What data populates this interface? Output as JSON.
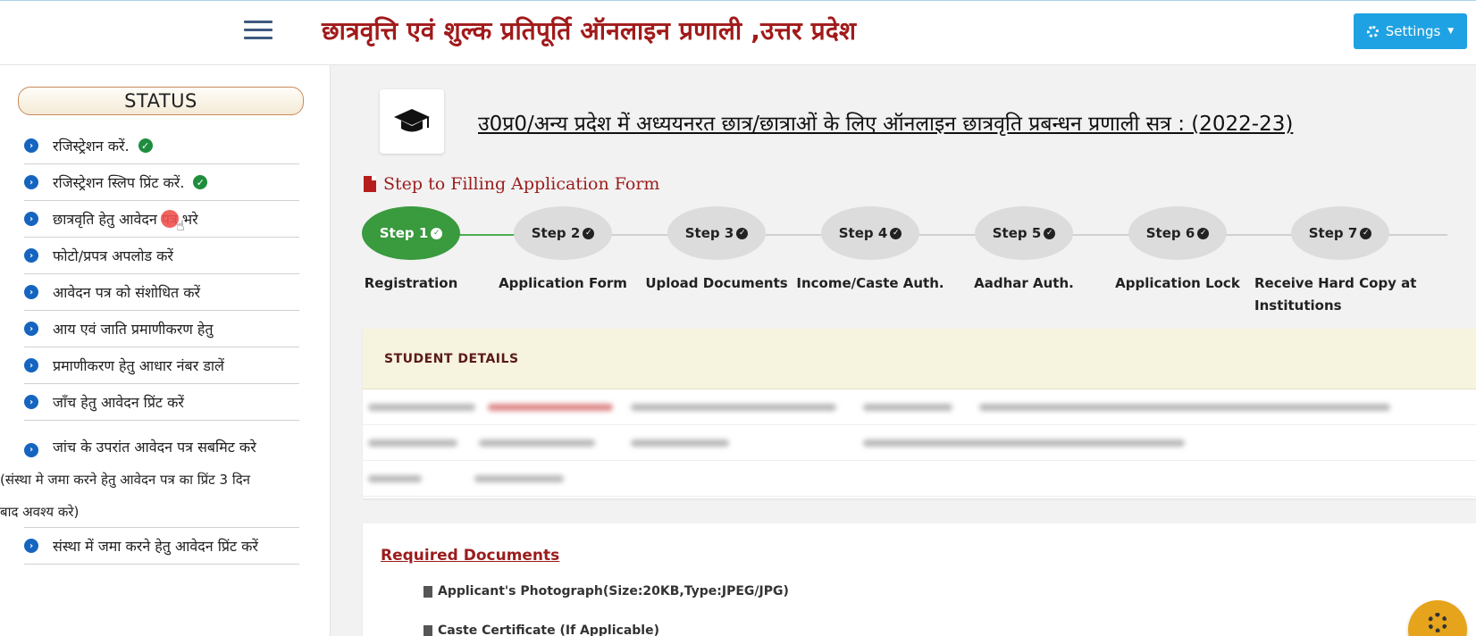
{
  "header": {
    "title": "छात्रवृत्ति एवं शुल्क प्रतिपूर्ति ऑनलाइन प्रणाली ,उत्तर प्रदेश",
    "settings_label": "Settings",
    "menu_icon": "hamburger-icon",
    "settings_icon": "gear-icon"
  },
  "sidebar": {
    "status_label": "STATUS",
    "items": [
      {
        "label": "रजिस्ट्रेशन करें.",
        "done": true
      },
      {
        "label": "रजिस्ट्रेशन स्लिप प्रिंट करें.",
        "done": true
      },
      {
        "label": "छात्रवृति हेतु आवेदन पत्र भरे",
        "done": false
      },
      {
        "label": "फोटो/प्रपत्र अपलोड करें",
        "done": false
      },
      {
        "label": "आवेदन पत्र को संशोधित करें",
        "done": false
      },
      {
        "label": "आय एवं जाति प्रमाणीकरण हेतु",
        "done": false
      },
      {
        "label": "प्रमाणीकरण हेतु आधार नंबर डालें",
        "done": false
      },
      {
        "label": "जाँच हेतु आवेदन प्रिंट करें",
        "done": false
      },
      {
        "label": "जांच के उपरांत आवेदन पत्र सबमिट करे",
        "note_line1": "(संस्था मे जमा करने हेतु आवेदन पत्र का प्रिंट 3 दिन",
        "note_line2": "बाद अवश्य करे)",
        "done": false
      },
      {
        "label": "संस्था में जमा करने हेतु आवेदन प्रिंट करें",
        "done": false
      }
    ]
  },
  "main": {
    "page_title": "उ0प्र0/अन्य प्रदेश में अध्ययनरत छात्र/छात्राओं के लिए ऑनलाइन छात्रवृति प्रबन्धन प्रणाली सत्र : (2022-23)",
    "step_heading": "Step to Filling Application Form",
    "steps": [
      {
        "label": "Step 1",
        "name": "Registration",
        "active": true
      },
      {
        "label": "Step 2",
        "name": "Application Form",
        "active": false
      },
      {
        "label": "Step 3",
        "name": "Upload Documents",
        "active": false
      },
      {
        "label": "Step 4",
        "name": "Income/Caste Auth.",
        "active": false
      },
      {
        "label": "Step 5",
        "name": "Aadhar Auth.",
        "active": false
      },
      {
        "label": "Step 6",
        "name": "Application Lock",
        "active": false
      },
      {
        "label": "Step 7",
        "name": "Receive Hard Copy at Institutions",
        "active": false
      }
    ],
    "student_details_title": "STUDENT DETAILS",
    "required_docs_title": "Required Documents",
    "documents": [
      "Applicant's Photograph(Size:20KB,Type:JPEG/JPG)",
      "Caste Certificate (If Applicable)"
    ]
  },
  "colors": {
    "brand_red": "#a11a1a",
    "settings_blue": "#1fa2e3",
    "step_active_green": "#3a9a3e",
    "step_inactive_gray": "#dcdcdc",
    "fab_orange": "#e6a41c"
  }
}
